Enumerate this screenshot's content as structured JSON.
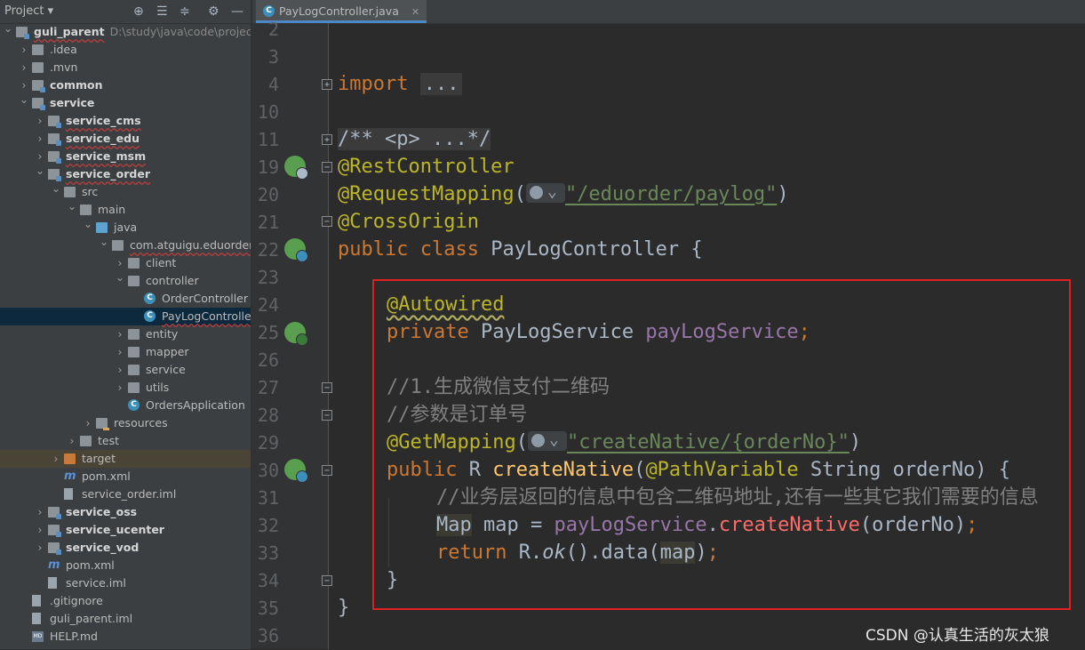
{
  "project_panel": {
    "title": "Project",
    "tree": [
      {
        "label": "guli_parent",
        "path": "D:\\study\\java\\code\\project\\guli_",
        "depth": 0,
        "arrow": "down",
        "icon": "folder-module",
        "bold": true,
        "wavy": true
      },
      {
        "label": ".idea",
        "depth": 1,
        "arrow": "right",
        "icon": "folder"
      },
      {
        "label": ".mvn",
        "depth": 1,
        "arrow": "right",
        "icon": "folder"
      },
      {
        "label": "common",
        "depth": 1,
        "arrow": "right",
        "icon": "folder-module",
        "bold": true
      },
      {
        "label": "service",
        "depth": 1,
        "arrow": "down",
        "icon": "folder-module",
        "bold": true
      },
      {
        "label": "service_cms",
        "depth": 2,
        "arrow": "right",
        "icon": "folder-module",
        "bold": true,
        "wavy": true
      },
      {
        "label": "service_edu",
        "depth": 2,
        "arrow": "right",
        "icon": "folder-module",
        "bold": true,
        "wavy": true
      },
      {
        "label": "service_msm",
        "depth": 2,
        "arrow": "right",
        "icon": "folder-module",
        "bold": true,
        "wavy": true
      },
      {
        "label": "service_order",
        "depth": 2,
        "arrow": "down",
        "icon": "folder-module",
        "bold": true,
        "wavy": true
      },
      {
        "label": "src",
        "depth": 3,
        "arrow": "down",
        "icon": "folder"
      },
      {
        "label": "main",
        "depth": 4,
        "arrow": "down",
        "icon": "folder"
      },
      {
        "label": "java",
        "depth": 5,
        "arrow": "down",
        "icon": "folder-src"
      },
      {
        "label": "com.atguigu.eduorder",
        "depth": 6,
        "arrow": "down",
        "icon": "folder",
        "wavy": true
      },
      {
        "label": "client",
        "depth": 7,
        "arrow": "right",
        "icon": "folder"
      },
      {
        "label": "controller",
        "depth": 7,
        "arrow": "down",
        "icon": "folder"
      },
      {
        "label": "OrderController",
        "depth": 8,
        "arrow": "",
        "icon": "class"
      },
      {
        "label": "PayLogController",
        "depth": 8,
        "arrow": "",
        "icon": "class",
        "selected": true,
        "wavy": true
      },
      {
        "label": "entity",
        "depth": 7,
        "arrow": "right",
        "icon": "folder"
      },
      {
        "label": "mapper",
        "depth": 7,
        "arrow": "right",
        "icon": "folder"
      },
      {
        "label": "service",
        "depth": 7,
        "arrow": "right",
        "icon": "folder"
      },
      {
        "label": "utils",
        "depth": 7,
        "arrow": "right",
        "icon": "folder"
      },
      {
        "label": "OrdersApplication",
        "depth": 7,
        "arrow": "",
        "icon": "class-app"
      },
      {
        "label": "resources",
        "depth": 5,
        "arrow": "right",
        "icon": "folder-res"
      },
      {
        "label": "test",
        "depth": 4,
        "arrow": "right",
        "icon": "folder"
      },
      {
        "label": "target",
        "depth": 3,
        "arrow": "right",
        "icon": "folder-orange",
        "excluded": true
      },
      {
        "label": "pom.xml",
        "depth": 3,
        "arrow": "",
        "icon": "maven"
      },
      {
        "label": "service_order.iml",
        "depth": 3,
        "arrow": "",
        "icon": "file"
      },
      {
        "label": "service_oss",
        "depth": 2,
        "arrow": "right",
        "icon": "folder-module",
        "bold": true
      },
      {
        "label": "service_ucenter",
        "depth": 2,
        "arrow": "right",
        "icon": "folder-module",
        "bold": true
      },
      {
        "label": "service_vod",
        "depth": 2,
        "arrow": "right",
        "icon": "folder-module",
        "bold": true
      },
      {
        "label": "pom.xml",
        "depth": 2,
        "arrow": "",
        "icon": "maven"
      },
      {
        "label": "service.iml",
        "depth": 2,
        "arrow": "",
        "icon": "file"
      },
      {
        "label": ".gitignore",
        "depth": 1,
        "arrow": "",
        "icon": "file"
      },
      {
        "label": "guli_parent.iml",
        "depth": 1,
        "arrow": "",
        "icon": "file"
      },
      {
        "label": "HELP.md",
        "depth": 1,
        "arrow": "",
        "icon": "md"
      }
    ]
  },
  "editor": {
    "tab_label": "PayLogController.java",
    "tab_icon": "class-icon",
    "line_numbers": [
      "2",
      "3",
      "4",
      "10",
      "11",
      "19",
      "20",
      "21",
      "22",
      "23",
      "24",
      "25",
      "26",
      "27",
      "28",
      "29",
      "30",
      "31",
      "32",
      "33",
      "34",
      "35",
      "36"
    ],
    "code": {
      "import_kw": "import",
      "import_fold": "...",
      "javadoc": "/** <p> ...*/",
      "ann_rest": "@RestController",
      "ann_reqmap": "@RequestMapping",
      "reqmap_path": "\"/eduorder/paylog\"",
      "ann_cross": "@CrossOrigin",
      "class_kw1": "public",
      "class_kw2": "class",
      "class_name": "PayLogController {",
      "ann_autowired": "@Autowired",
      "field_kw": "private",
      "field_type": "PayLogService",
      "field_name": "payLogService",
      "comment1": "//1.生成微信支付二维码",
      "comment2": "//参数是订单号",
      "ann_getmap": "@GetMapping",
      "getmap_path": "\"createNative/{orderNo}\"",
      "method_kw": "public",
      "method_ret": "R",
      "method_name": "createNative",
      "ann_pathvar": "@PathVariable",
      "param": "String orderNo) {",
      "comment3": "//业务层返回的信息中包含二维码地址,还有一些其它我们需要的信息",
      "map_type": "Map",
      "map_var": "map =",
      "call_obj": "payLogService",
      "call_method": "createNative",
      "call_arg": "(orderNo)",
      "ret_kw": "return",
      "ret_ok": "ok",
      "ret_data": "().data(",
      "ret_map": "map",
      "close_method": "}",
      "close_class": "}"
    }
  },
  "watermark": "CSDN @认真生活的灰太狼"
}
